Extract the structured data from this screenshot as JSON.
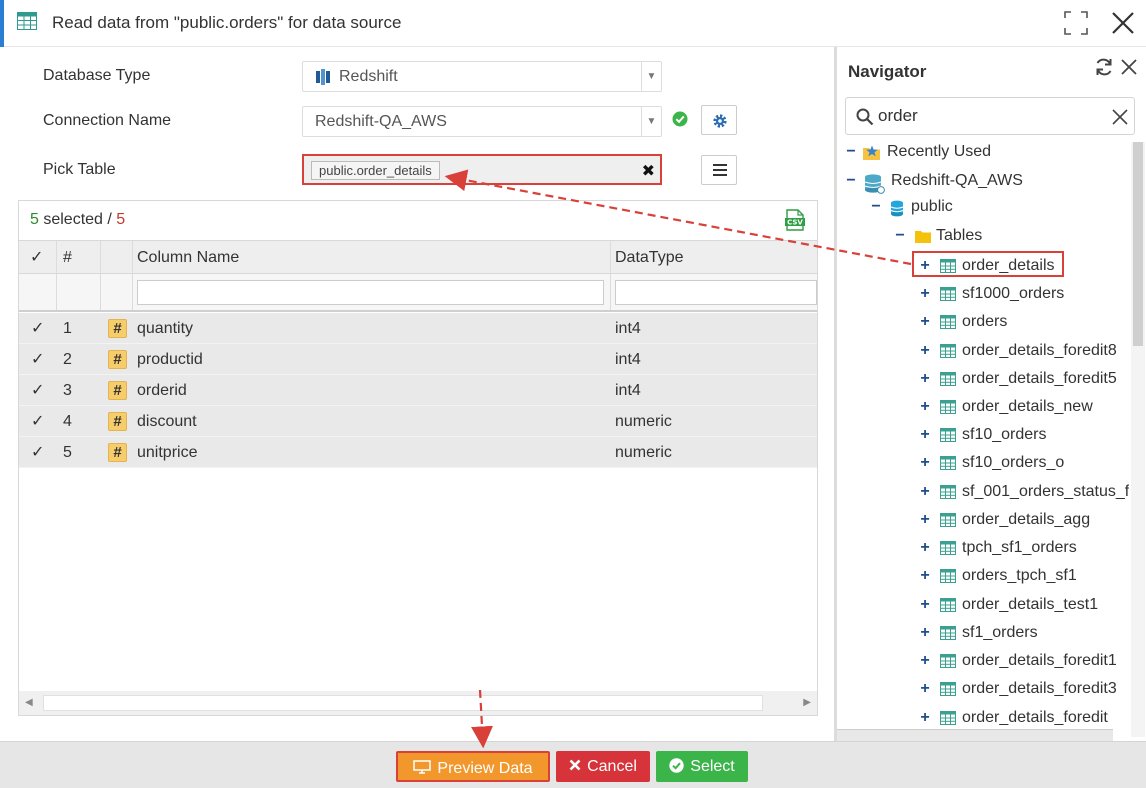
{
  "window": {
    "title": "Read data from \"public.orders\" for data source"
  },
  "form": {
    "database_type_label": "Database Type",
    "database_type_value": "Redshift",
    "connection_name_label": "Connection Name",
    "connection_name_value": "Redshift-QA_AWS",
    "pick_table_label": "Pick Table",
    "pick_table_value": "public.order_details"
  },
  "grid": {
    "selected_count": "5",
    "selected_text": " selected / ",
    "total_count": "5",
    "headers": {
      "check": "✓",
      "number": "#",
      "column_name": "Column Name",
      "datatype": "DataType"
    },
    "rows": [
      {
        "num": "1",
        "name": "quantity",
        "type": "int4",
        "checked": "✓",
        "type_icon": "#"
      },
      {
        "num": "2",
        "name": "productid",
        "type": "int4",
        "checked": "✓",
        "type_icon": "#"
      },
      {
        "num": "3",
        "name": "orderid",
        "type": "int4",
        "checked": "✓",
        "type_icon": "#"
      },
      {
        "num": "4",
        "name": "discount",
        "type": "numeric",
        "checked": "✓",
        "type_icon": "#"
      },
      {
        "num": "5",
        "name": "unitprice",
        "type": "numeric",
        "checked": "✓",
        "type_icon": "#"
      }
    ]
  },
  "navigator": {
    "title": "Navigator",
    "search_value": "order",
    "tree": {
      "recently_used": "Recently Used",
      "connection": "Redshift-QA_AWS",
      "schema": "public",
      "tables_folder": "Tables",
      "tables": [
        "order_details",
        "sf1000_orders",
        "orders",
        "order_details_foredit8",
        "order_details_foredit5",
        "order_details_new",
        "sf10_orders",
        "sf10_orders_o",
        "sf_001_orders_status_f",
        "order_details_agg",
        "tpch_sf1_orders",
        "orders_tpch_sf1",
        "order_details_test1",
        "sf1_orders",
        "order_details_foredit1",
        "order_details_foredit3",
        "order_details_foredit"
      ],
      "expand_glyph": "+",
      "collapse_glyph": "−"
    }
  },
  "footer": {
    "preview_label": "Preview Data",
    "cancel_label": "Cancel",
    "select_label": "Select"
  },
  "icons": {
    "title": "table-icon",
    "maximize": "maximize-icon",
    "close": "close-icon",
    "redshift": "redshift-icon",
    "connection_ok": "check-circle-icon",
    "settings": "gear-icon",
    "menu": "menu-icon",
    "csv": "csv-export-icon",
    "refresh": "refresh-icon",
    "search": "search-icon"
  },
  "colors": {
    "accent": "#2a7fd4",
    "highlight": "#d9403a",
    "preview": "#f2972c",
    "cancel": "#d6343a",
    "select": "#3bb44a",
    "ok": "#3bb44a"
  }
}
